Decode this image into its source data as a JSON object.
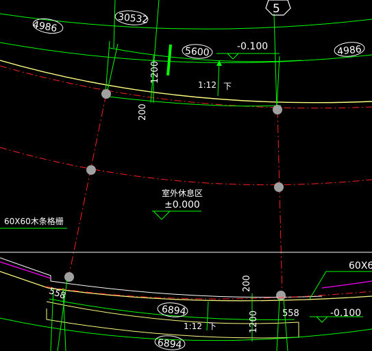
{
  "drawing": {
    "grid_bubble": "5",
    "dims": {
      "d4986_left": "4986",
      "d30532": "30532",
      "d5600": "5600",
      "d4986_right": "4986",
      "d1200_top": "1200",
      "d200_top": "200",
      "d558_left": "558",
      "d200_bottom": "200",
      "d6894_a": "6894",
      "d558_right": "558",
      "d1200_bottom": "1200",
      "d6894_b": "6894"
    },
    "levels": {
      "top": "-0.100",
      "area": "±0.000",
      "bottom": "-0.100"
    },
    "slopes": {
      "top": "1:12",
      "top_arrow": "下",
      "bottom": "1:12",
      "bottom_arrow": "下"
    },
    "labels": {
      "area_name": "室外休息区",
      "grille_left": "60X60木条格栅",
      "grille_right": "60X6"
    },
    "colors": {
      "background": "#000000",
      "green": "#00ff00",
      "red": "#ff2020",
      "yellow": "#ffff80",
      "magenta": "#ff00ff",
      "white": "#ffffff",
      "column": "#a0a0a0"
    }
  }
}
